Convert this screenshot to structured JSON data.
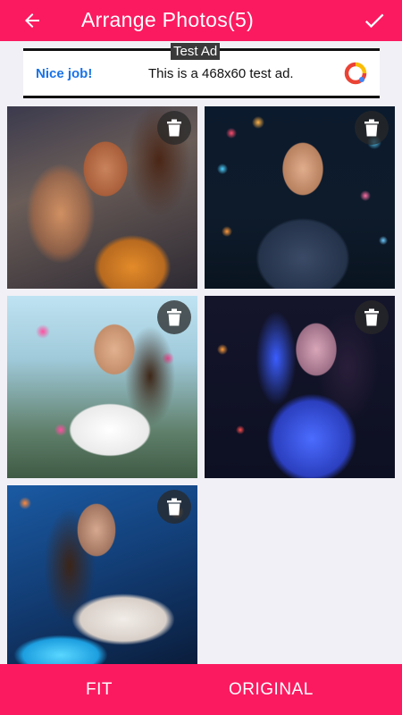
{
  "header": {
    "title": "Arrange Photos(5)",
    "back_icon": "arrow-left-icon",
    "done_icon": "check-icon",
    "bar_color": "#fb1a60"
  },
  "ad": {
    "badge": "Test Ad",
    "headline": "Nice job!",
    "body": "This is a 468x60 test ad.",
    "logo_icon": "admob-logo-icon"
  },
  "photos": [
    {
      "name": "photo-1",
      "delete_icon": "trash-icon"
    },
    {
      "name": "photo-2",
      "delete_icon": "trash-icon"
    },
    {
      "name": "photo-3",
      "delete_icon": "trash-icon"
    },
    {
      "name": "photo-4",
      "delete_icon": "trash-icon"
    },
    {
      "name": "photo-5",
      "delete_icon": "trash-icon"
    }
  ],
  "footer": {
    "fit_label": "FIT",
    "original_label": "ORIGINAL"
  }
}
